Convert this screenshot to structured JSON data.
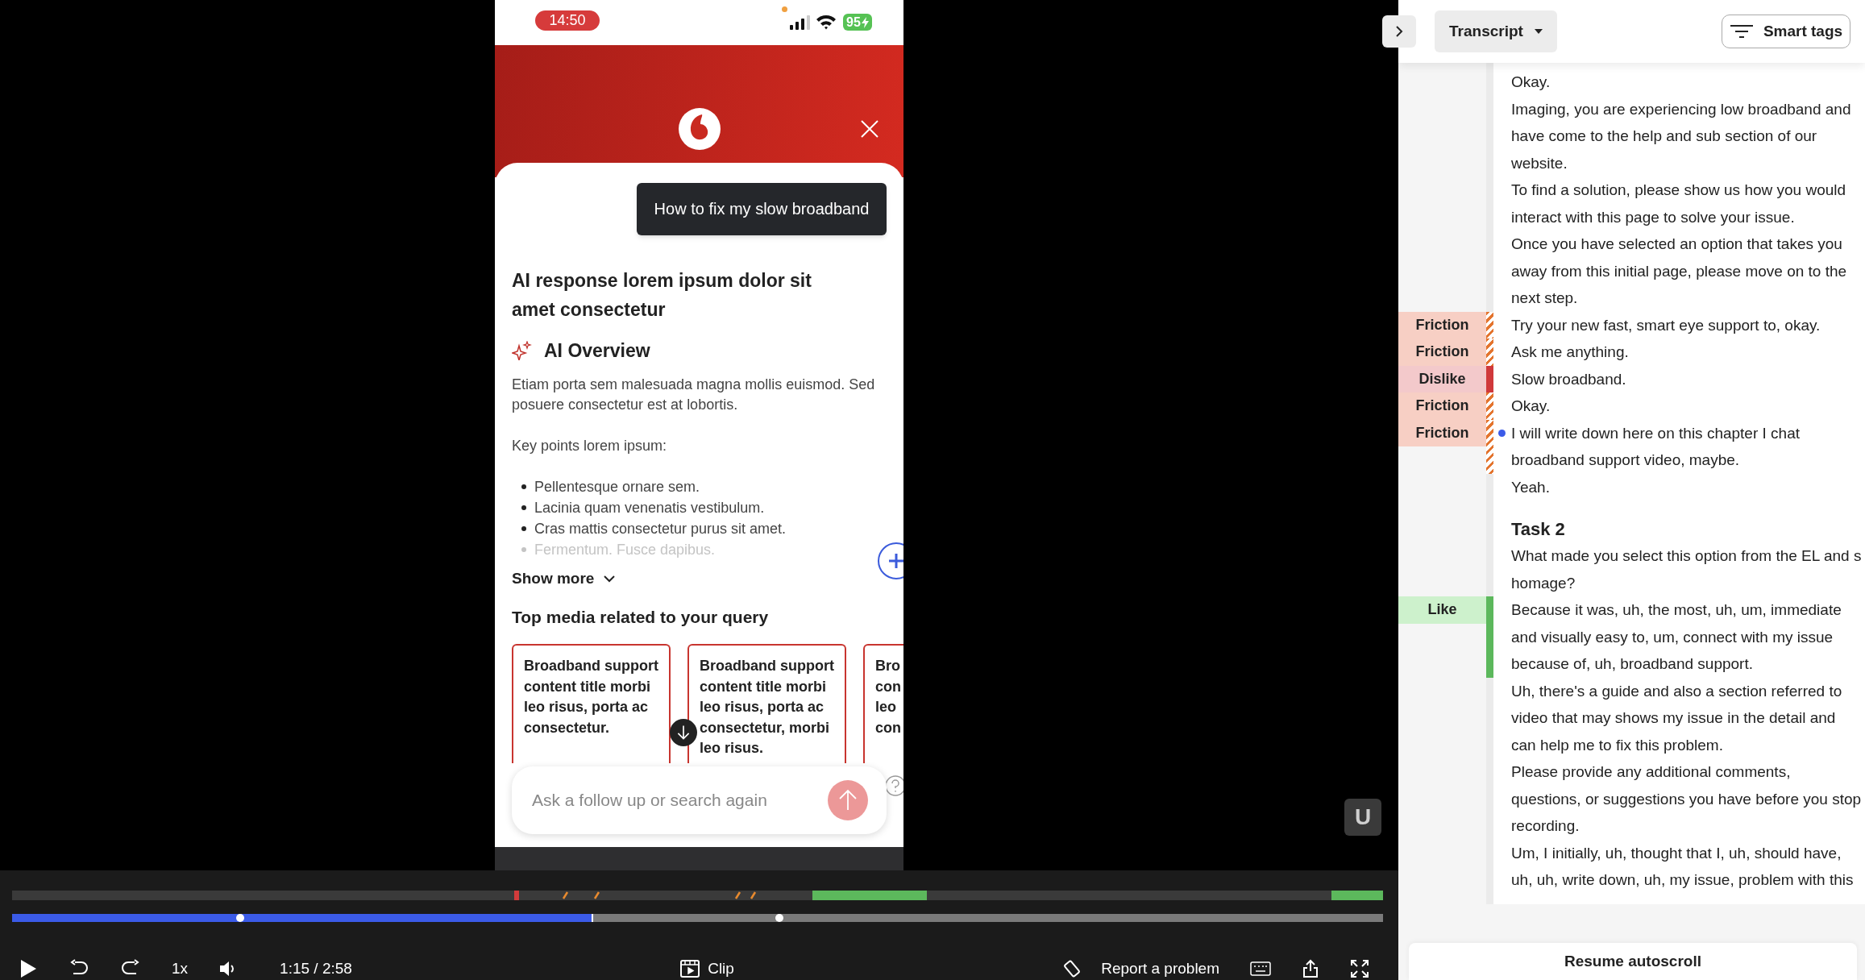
{
  "player": {
    "phone": {
      "status_time": "14:50",
      "battery": "95",
      "query": "How to fix my slow broadband",
      "title": "AI response lorem ipsum dolor sit amet consectetur",
      "overview_heading": "AI Overview",
      "overview_text": "Etiam porta sem malesuada magna mollis euismod. Sed posuere consectetur est at lobortis.",
      "key_points_label": "Key points lorem ipsum:",
      "key_points": [
        {
          "text": "Pellentesque ornare sem.",
          "faded": false
        },
        {
          "text": "Lacinia quam venenatis vestibulum.",
          "faded": false
        },
        {
          "text": "Cras mattis consectetur purus sit amet.",
          "faded": false
        },
        {
          "text": "Fermentum. Fusce dapibus.",
          "faded": true
        }
      ],
      "show_more": "Show more",
      "media_heading": "Top media related to your query",
      "media_cards": [
        {
          "lines": [
            "Broadband support",
            "content title morbi",
            "leo risus, porta ac",
            "consectetur."
          ]
        },
        {
          "lines": [
            "Broadband support",
            "content title morbi",
            "leo risus, porta ac",
            "consectetur, morbi",
            "leo risus."
          ]
        },
        {
          "lines": [
            "Bro",
            "con",
            "leo",
            "con"
          ]
        }
      ],
      "search_placeholder": "Ask a follow up or search again"
    },
    "overlay_badge": "U",
    "progress": {
      "level": 0.424
    },
    "controls": {
      "speed": "1x",
      "time": "1:15 / 2:58",
      "clip": "Clip",
      "report": "Report a problem"
    }
  },
  "transcript": {
    "view_menu": "Transcript",
    "smart_tags": "Smart tags",
    "entries": [
      {
        "kind": "line",
        "text": "Okay.",
        "current": false
      },
      {
        "kind": "line",
        "text": "Imaging, you are experiencing low broadband and have come to the help and sub section of our website.",
        "current": false
      },
      {
        "kind": "line",
        "text": "To find a solution, please show us how you would interact with this page to solve your issue.",
        "current": false
      },
      {
        "kind": "line",
        "text": "Once you have selected an option that takes you away from this initial page, please move on to the next step.",
        "current": false
      },
      {
        "kind": "line",
        "text": "Try your new fast, smart eye support to, okay.",
        "tag": {
          "label": "Friction",
          "kind": "friction"
        },
        "current": false
      },
      {
        "kind": "line",
        "text": "Ask me anything.",
        "tag": {
          "label": "Friction",
          "kind": "friction"
        },
        "current": false
      },
      {
        "kind": "line",
        "text": "Slow broadband.",
        "tag": {
          "label": "Dislike",
          "kind": "dislike"
        },
        "current": false
      },
      {
        "kind": "line",
        "text": "Okay.",
        "tag": {
          "label": "Friction",
          "kind": "friction"
        },
        "current": false
      },
      {
        "kind": "line",
        "text": "I will write down here on this chapter I chat broadband support video, maybe.",
        "tag": {
          "label": "Friction",
          "kind": "friction"
        },
        "current": true
      },
      {
        "kind": "line",
        "text": "Yeah.",
        "current": false
      },
      {
        "kind": "heading",
        "text": "Task 2",
        "current": false
      },
      {
        "kind": "line",
        "text": "What made you select this option from the EL and s homage?",
        "current": false
      },
      {
        "kind": "line",
        "text": "Because it was, uh, the most, uh, um, immediate and visually easy to, um, connect with my issue because of, uh, broadband support.",
        "tag": {
          "label": "Like",
          "kind": "like"
        },
        "current": false
      },
      {
        "kind": "line",
        "text": "Uh, there's a guide and also a section referred to video that may shows my issue in the detail and can help me to fix this problem.",
        "current": false
      },
      {
        "kind": "line",
        "text": "Please provide any additional comments, questions, or suggestions you have before you stop recording.",
        "current": false
      },
      {
        "kind": "line",
        "text": "Um, I initially, uh, thought that I, uh, should have, uh, uh, write down, uh, my issue, problem with this",
        "current": false
      }
    ],
    "resume_button": "Resume autoscroll"
  }
}
